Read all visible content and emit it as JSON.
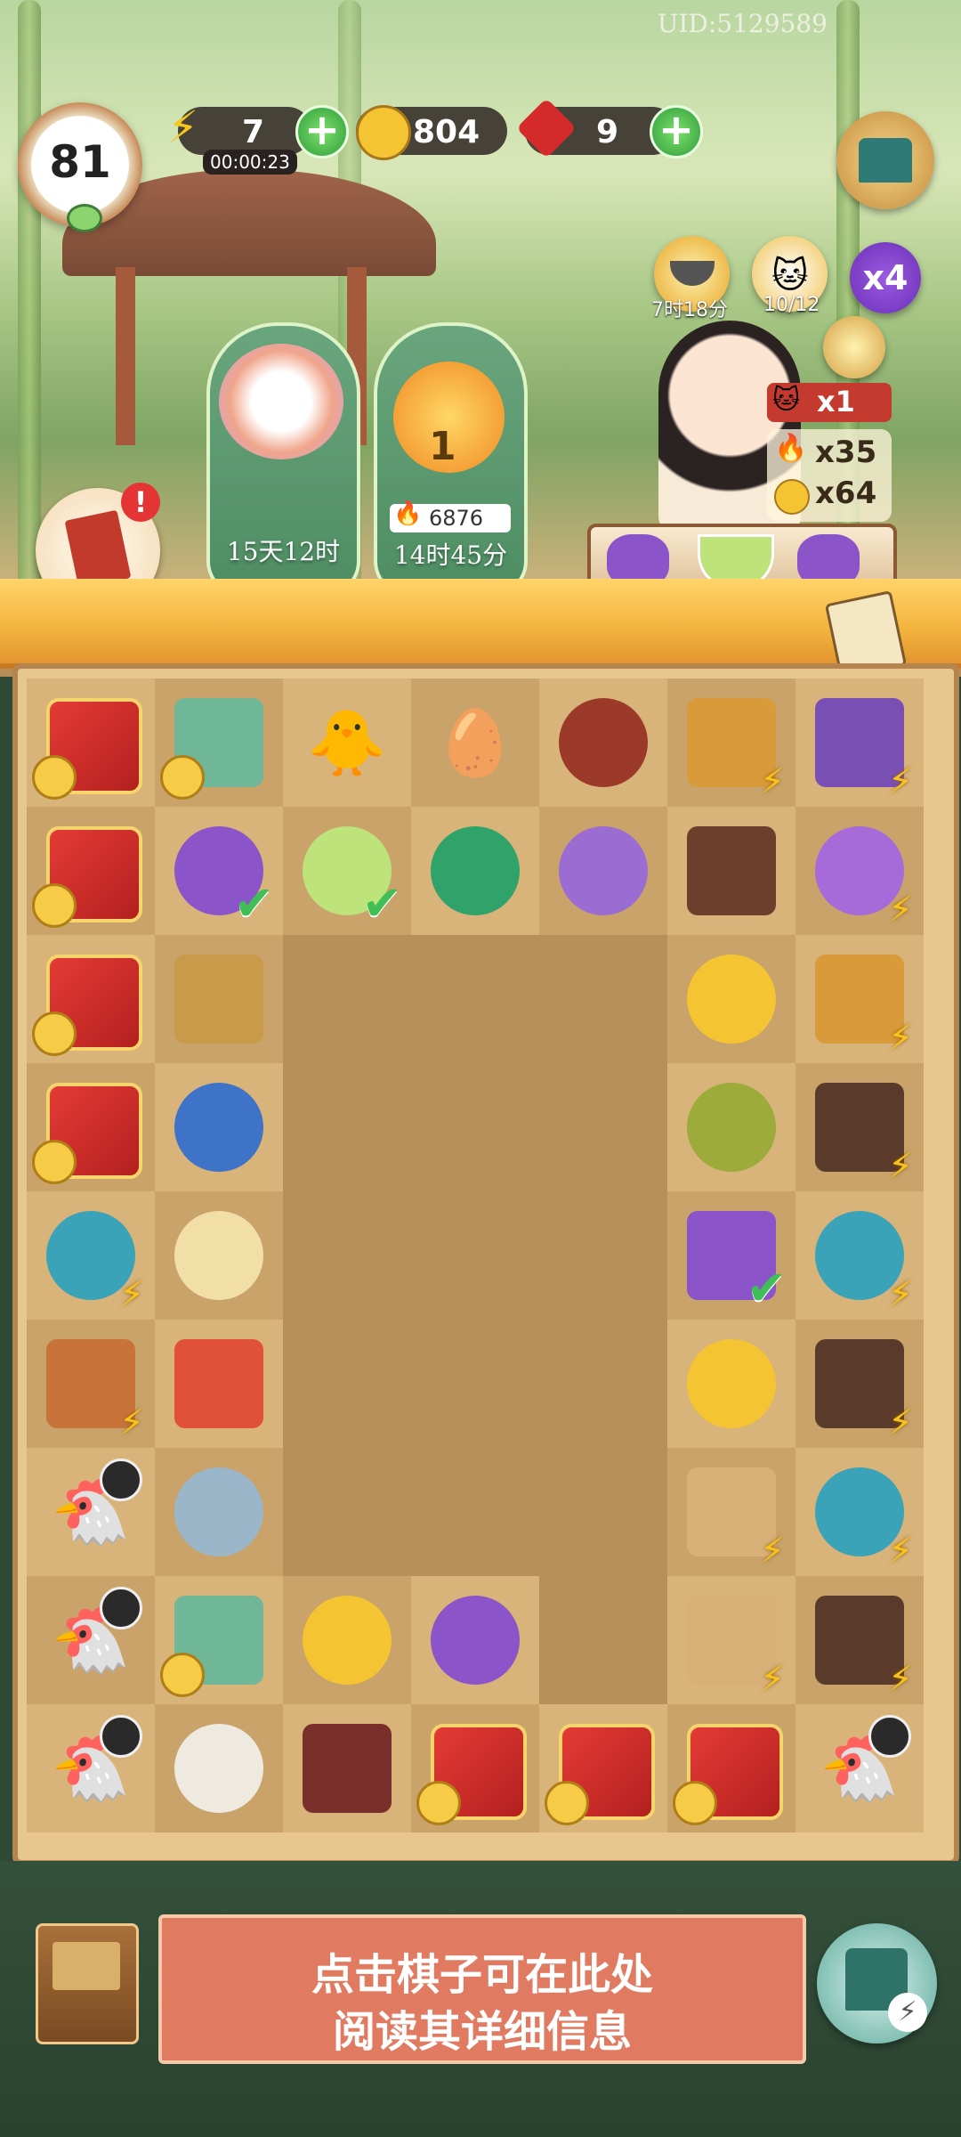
{
  "uid": "UID:5129589",
  "level": "81",
  "energy": {
    "value": "7",
    "timer": "00:00:23"
  },
  "coins": "804",
  "gems": "9",
  "top_icons": {
    "bowl_timer": "7时18分",
    "cat_progress": "10/12",
    "multiplier": "x4"
  },
  "events": [
    {
      "time": "15天12时"
    },
    {
      "badge": "1",
      "score": "6876",
      "time": "14时45分"
    }
  ],
  "order": {
    "cat_count": "x1",
    "reward_fire": "x35",
    "reward_coin": "x64"
  },
  "info_text": [
    "点击棋子可在此处",
    "阅读其详细信息"
  ],
  "colors": {
    "accent": "#e07a60",
    "board": "#e7c690",
    "banner": "#f3b33e"
  }
}
